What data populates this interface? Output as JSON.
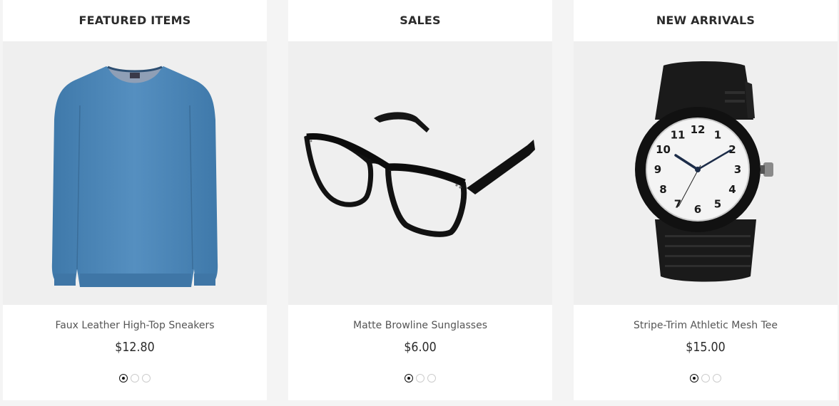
{
  "panels": [
    {
      "title": "FEATURED ITEMS",
      "product": {
        "image": "blue-sweater-image",
        "name": "Faux Leather High-Top Sneakers",
        "price": "$12.80"
      },
      "slider": {
        "total": 3,
        "active": 1
      }
    },
    {
      "title": "SALES",
      "product": {
        "image": "black-glasses-image",
        "name": "Matte Browline Sunglasses",
        "price": "$6.00"
      },
      "slider": {
        "total": 3,
        "active": 1
      }
    },
    {
      "title": "NEW ARRIVALS",
      "product": {
        "image": "black-wristwatch-image",
        "name": "Stripe-Trim Athletic Mesh Tee",
        "price": "$15.00"
      },
      "slider": {
        "total": 3,
        "active": 1
      },
      "watch_numerals": [
        "12",
        "1",
        "2",
        "3",
        "4",
        "5",
        "6",
        "7",
        "8",
        "9",
        "10",
        "11"
      ]
    }
  ],
  "colors": {
    "page_background": "#f4f4f4",
    "panel_background": "#ffffff",
    "image_background": "#efefef",
    "sweater": "#4a86b8",
    "frame": "#111111",
    "title_text": "#2b2b2b",
    "name_text": "#555555"
  }
}
